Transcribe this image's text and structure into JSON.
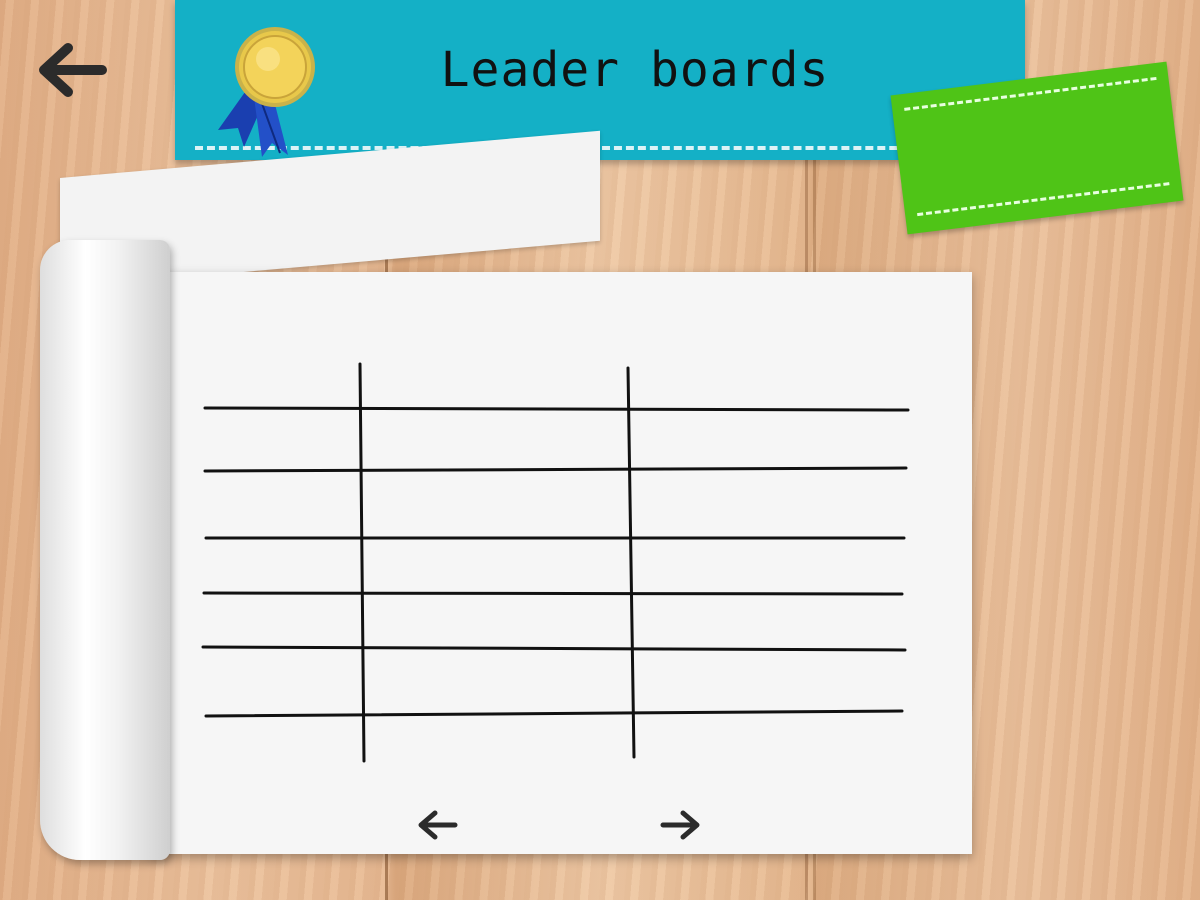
{
  "screen": {
    "title": "Leader boards"
  },
  "icons": {
    "back": "arrow-left-icon",
    "medal": "gold-medal-icon",
    "prev_page": "arrow-left-icon",
    "next_page": "arrow-right-icon"
  },
  "colors": {
    "banner": "#14b0c6",
    "tag": "#4fc417",
    "paper": "#f6f6f6",
    "ink": "#111111"
  },
  "leaderboard": {
    "columns": [
      "",
      "",
      ""
    ],
    "rows": [
      [
        "",
        "",
        ""
      ],
      [
        "",
        "",
        ""
      ],
      [
        "",
        "",
        ""
      ],
      [
        "",
        "",
        ""
      ],
      [
        "",
        "",
        ""
      ]
    ]
  }
}
